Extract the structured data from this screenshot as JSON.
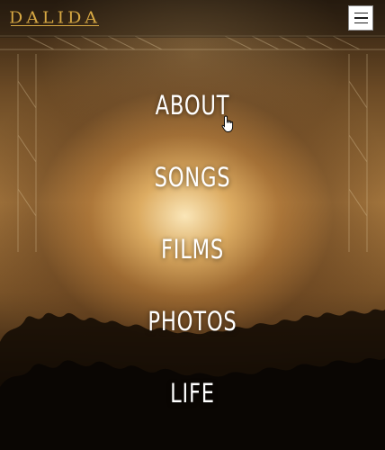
{
  "header": {
    "logo": "DALIDA",
    "menu_icon": "hamburger-menu-icon"
  },
  "nav": {
    "items": [
      {
        "label": "ABOUT"
      },
      {
        "label": "SONGS"
      },
      {
        "label": "FILMS"
      },
      {
        "label": "PHOTOS"
      },
      {
        "label": "LIFE"
      }
    ]
  },
  "background": {
    "image": "concert-crowd-stage-lights"
  },
  "colors": {
    "logo": "#d7a843",
    "nav_text": "#ffffff"
  },
  "cursor": "hand-pointer-icon"
}
